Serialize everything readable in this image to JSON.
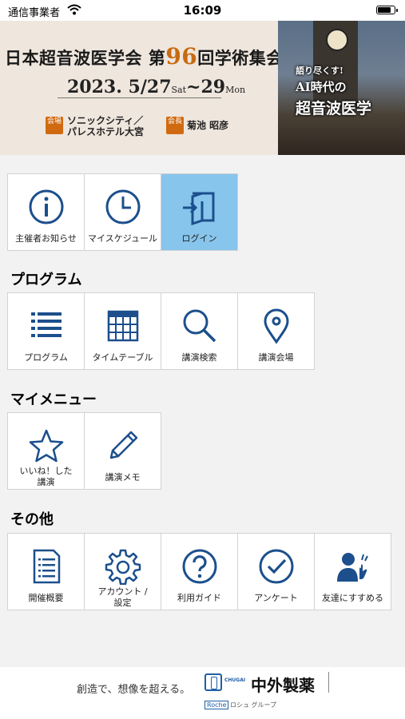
{
  "status_bar": {
    "carrier": "通信事業者",
    "time": "16:09",
    "battery_level": 0.85
  },
  "banner": {
    "title_pre": "日本超音波医学会 第",
    "title_num": "96",
    "title_post": "回学術集会",
    "date_main": "2023. 5/27",
    "date_sat": "Sat",
    "date_mid": "~29",
    "date_mon": "Mon",
    "venue_badge": "会場",
    "venue_line1": "ソニックシティ／",
    "venue_line2": "パレスホテル大宮",
    "chair_badge": "会長",
    "chair_name": "菊池 昭彦",
    "photo_t1": "語り尽くす!",
    "photo_t2": "AI時代の",
    "photo_t3": "超音波医学"
  },
  "top_menu": [
    {
      "label": "主催者お知らせ",
      "icon": "info-icon"
    },
    {
      "label": "マイスケジュール",
      "icon": "clock-icon"
    },
    {
      "label": "ログイン",
      "icon": "login-icon"
    }
  ],
  "sections": {
    "program": "プログラム",
    "my_menu": "マイメニュー",
    "other": "その他"
  },
  "program_menu": [
    {
      "label": "プログラム",
      "icon": "list-icon"
    },
    {
      "label": "タイムテーブル",
      "icon": "calendar-icon"
    },
    {
      "label": "講演検索",
      "icon": "search-icon"
    },
    {
      "label": "講演会場",
      "icon": "location-pin-icon"
    }
  ],
  "my_menu": [
    {
      "label_1": "いいね！した",
      "label_2": "講演",
      "icon": "star-icon"
    },
    {
      "label": "講演メモ",
      "icon": "pencil-icon"
    }
  ],
  "other_menu": [
    {
      "label": "開催概要",
      "icon": "document-icon"
    },
    {
      "label_1": "アカウント /",
      "label_2": "設定",
      "icon": "gear-icon"
    },
    {
      "label": "利用ガイド",
      "icon": "question-icon"
    },
    {
      "label": "アンケート",
      "icon": "check-circle-icon"
    },
    {
      "label": "友達にすすめる",
      "icon": "recommend-friend-icon"
    }
  ],
  "footer": {
    "tagline": "創造で、想像を超える。",
    "logo_mini": "CHUGAI",
    "company": "中外製薬",
    "group_mark": "Roche",
    "group_text": "ロシュ グループ"
  },
  "colors": {
    "icon_blue": "#1c4f8c",
    "active_tile": "#87c5ec",
    "accent_orange": "#d06a10"
  }
}
